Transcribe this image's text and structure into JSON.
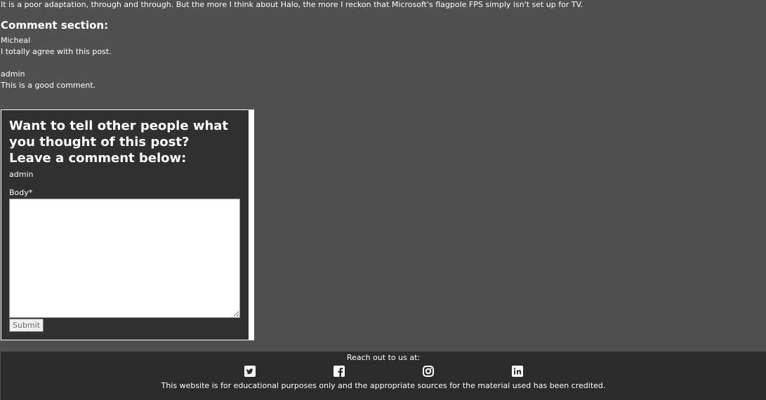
{
  "post": {
    "intro_text": "It is a poor adaptation, through and through. But the more I think about Halo, the more I reckon that Microsoft's flagpole FPS simply isn't set up for TV."
  },
  "comments_section": {
    "heading": "Comment section:",
    "comments": [
      {
        "author": "Micheal",
        "body": "I totally agree with this post."
      },
      {
        "author": "admin",
        "body": "This is a good comment."
      }
    ]
  },
  "comment_form": {
    "title": "Want to tell other people what you thought of this post? Leave a comment below:",
    "username": "admin",
    "body_label": "Body*",
    "body_value": "",
    "submit_label": "Submit"
  },
  "footer": {
    "reach_text": "Reach out to us at:",
    "social_icons": [
      "twitter-icon",
      "facebook-icon",
      "instagram-icon",
      "linkedin-icon"
    ],
    "note": "This website is for educational purposes only and the appropriate sources for the material used has been credited."
  },
  "colors": {
    "page_background": "#505050",
    "panel_background": "#303030",
    "footer_background": "#2b2b2b",
    "text": "#ffffff"
  }
}
